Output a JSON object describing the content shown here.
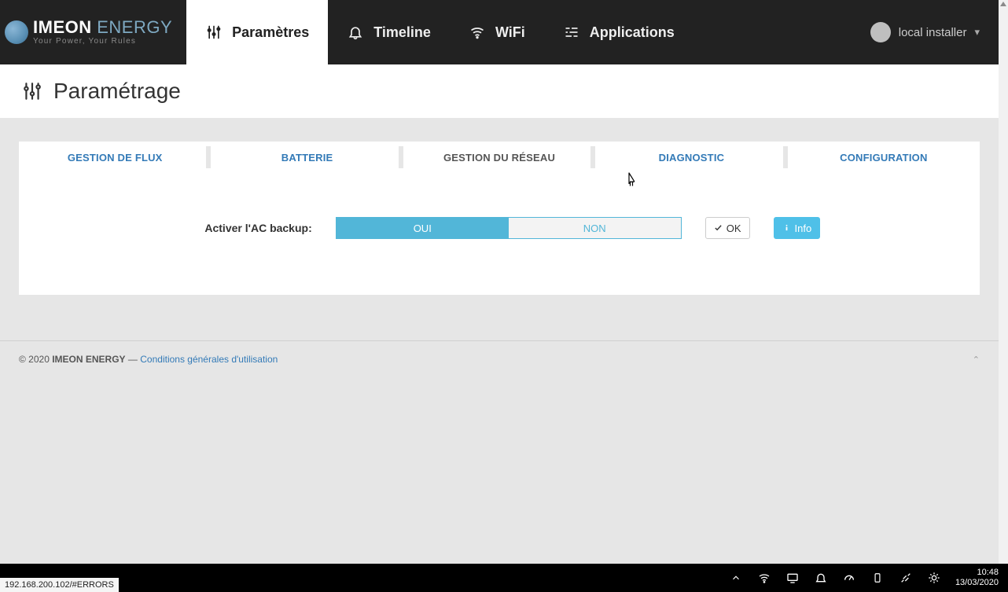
{
  "brand": {
    "line1_strong": "IMEON",
    "line1_light": " ENERGY",
    "tagline": "Your Power, Your Rules"
  },
  "nav": {
    "parametres": "Paramètres",
    "timeline": "Timeline",
    "wifi": "WiFi",
    "applications": "Applications"
  },
  "user": {
    "name": "local installer"
  },
  "page": {
    "title": "Paramétrage"
  },
  "tabs": {
    "flux": "GESTION DE FLUX",
    "batterie": "BATTERIE",
    "reseau": "GESTION DU RÉSEAU",
    "diagnostic": "DIAGNOSTIC",
    "configuration": "CONFIGURATION"
  },
  "setting": {
    "ac_backup_label": "Activer l'AC backup:",
    "oui": "OUI",
    "non": "NON",
    "ok": "OK",
    "info": "Info"
  },
  "footer": {
    "copyright": "© 2020 ",
    "brand": "IMEON ENERGY",
    "sep": " — ",
    "terms": "Conditions générales d'utilisation"
  },
  "taskbar": {
    "url": "192.168.200.102/#ERRORS",
    "time": "10:48",
    "date": "13/03/2020"
  }
}
